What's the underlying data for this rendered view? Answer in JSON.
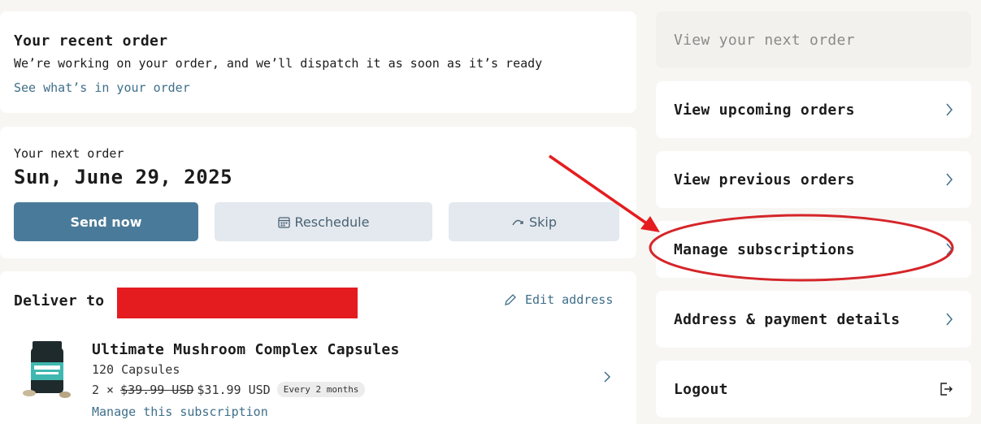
{
  "recent_order": {
    "title": "Your recent order",
    "description": "We’re working on your order, and we’ll dispatch it as soon as it’s ready",
    "link": "See what’s in your order"
  },
  "next_order": {
    "label": "Your next order",
    "date": "Sun, June 29, 2025",
    "send_now": "Send now",
    "reschedule": "Reschedule",
    "skip": "Skip"
  },
  "delivery": {
    "label": "Deliver to",
    "edit_address": "Edit address",
    "product": {
      "name": "Ultimate Mushroom Complex Capsules",
      "variant": "120 Capsules",
      "quantity_prefix": "2 ×",
      "original_price": "$39.99 USD",
      "price": "$31.99 USD",
      "frequency_badge": "Every 2 months",
      "manage_link": "Manage this subscription"
    }
  },
  "menu": {
    "view_next_order": "View your next order",
    "view_upcoming": "View upcoming orders",
    "view_previous": "View previous orders",
    "manage_subscriptions": "Manage subscriptions",
    "address_payment": "Address & payment details",
    "logout": "Logout"
  },
  "colors": {
    "accent": "#4a7a99",
    "link": "#3f6f8a",
    "annotation_red": "#e51c1f",
    "secondary_button": "#e3e9ee"
  }
}
